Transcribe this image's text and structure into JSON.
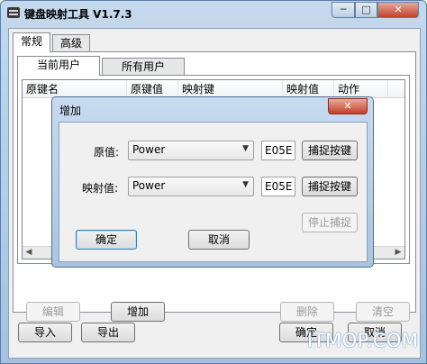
{
  "window": {
    "title": "键盘映射工具 V1.7.3",
    "minimize_glyph": "─",
    "maximize_glyph": "□",
    "close_glyph": "✕"
  },
  "tabs": [
    {
      "label": "常规",
      "active": true
    },
    {
      "label": "高级",
      "active": false
    }
  ],
  "subtabs": [
    {
      "label": "当前用户",
      "active": true
    },
    {
      "label": "所有用户",
      "active": false
    }
  ],
  "list": {
    "columns": [
      "原键名",
      "原键值",
      "映射键",
      "映射值",
      "动作"
    ],
    "rows": []
  },
  "buttons": {
    "edit": "编辑",
    "add": "增加",
    "delete": "删除",
    "clear": "清空",
    "import": "导入",
    "export": "导出",
    "ok": "确定",
    "cancel": "取消"
  },
  "dialog": {
    "title": "增加",
    "close_glyph": "✕",
    "original_label": "原值:",
    "original_value": "Power",
    "original_code": "E05E",
    "mapped_label": "映射值:",
    "mapped_value": "Power",
    "mapped_code": "E05E",
    "capture_key": "捕捉按键",
    "stop_capture": "停止捕捉",
    "ok": "确定",
    "cancel": "取消"
  },
  "watermark": "ITMOP.COM"
}
